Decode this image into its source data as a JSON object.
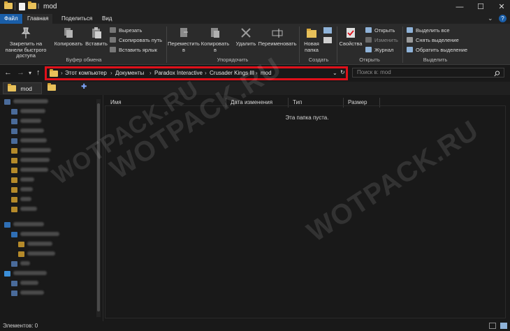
{
  "window": {
    "title": "mod",
    "minimize_glyph": "—",
    "maximize_glyph": "☐",
    "close_glyph": "✕",
    "help_glyph": "?",
    "ribbon_collapse_glyph": "⌄"
  },
  "ribbon_tabs": [
    "Файл",
    "Главная",
    "Поделиться",
    "Вид"
  ],
  "ribbon": {
    "clipboard": {
      "pin_label": "Закрепить на панели быстрого доступа",
      "copy_label": "Копировать",
      "paste_label": "Вставить",
      "cut_label": "Вырезать",
      "copy_path_label": "Скопировать путь",
      "paste_shortcut_label": "Вставить ярлык",
      "group_label": "Буфер обмена"
    },
    "organize": {
      "move_label": "Переместить в",
      "copy_to_label": "Копировать в",
      "delete_label": "Удалить",
      "rename_label": "Переименовать",
      "group_label": "Упорядочить"
    },
    "create": {
      "new_folder_label": "Новая папка",
      "group_label": "Создать"
    },
    "open": {
      "properties_label": "Свойства",
      "open_label": "Открыть",
      "edit_label": "Изменить",
      "history_label": "Журнал",
      "group_label": "Открыть"
    },
    "select": {
      "select_all_label": "Выделить все",
      "select_none_label": "Снять выделение",
      "invert_label": "Обратить выделение",
      "group_label": "Выделить"
    }
  },
  "address": {
    "crumbs": [
      "Этот компьютер",
      "Документы",
      "Paradox Interactive",
      "Crusader Kings III",
      "mod"
    ],
    "search_placeholder": "Поиск в: mod"
  },
  "folder_tabs": {
    "active": "mod",
    "add_glyph": "✚"
  },
  "columns": [
    "Имя",
    "Дата изменения",
    "Тип",
    "Размер"
  ],
  "empty_message": "Эта папка пуста.",
  "status": {
    "items_count": "Элементов: 0"
  },
  "watermark": "WOTPACK.RU",
  "colors": {
    "highlight_border": "#e0101a",
    "file_tab": "#1a5ea8",
    "folder": "#e8c15a"
  }
}
